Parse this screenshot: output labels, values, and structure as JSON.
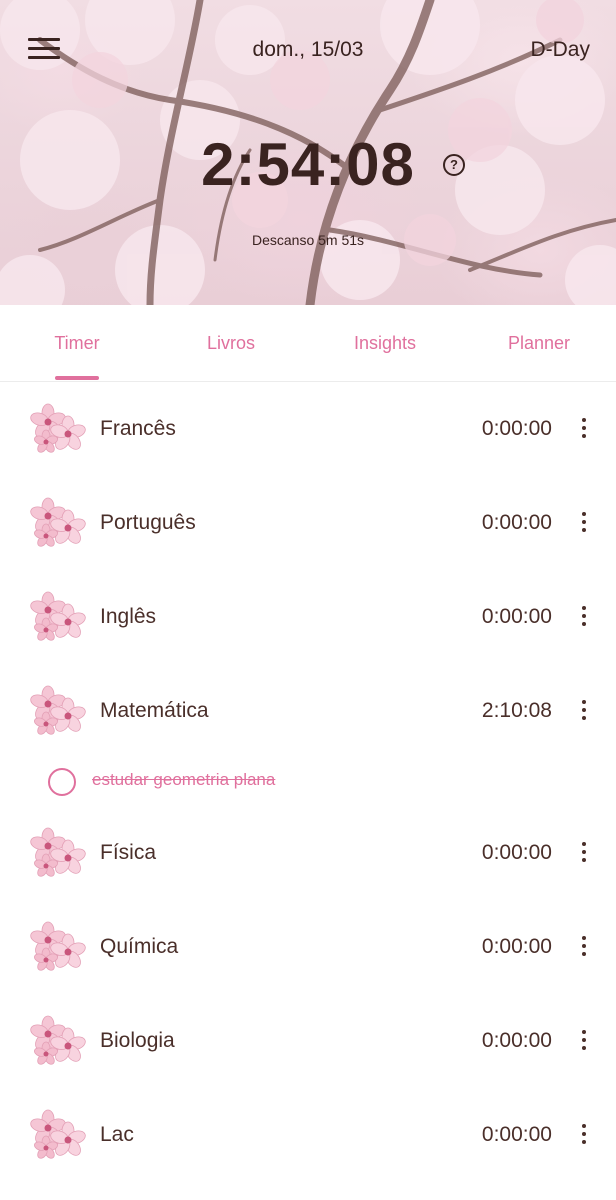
{
  "header": {
    "date": "dom., 15/03",
    "dday_label": "D-Day",
    "timer": "2:54:08",
    "help_glyph": "?",
    "rest_text": "Descanso 5m 51s"
  },
  "tabs": [
    {
      "label": "Timer",
      "active": true
    },
    {
      "label": "Livros",
      "active": false
    },
    {
      "label": "Insights",
      "active": false
    },
    {
      "label": "Planner",
      "active": false
    }
  ],
  "subjects": [
    {
      "name": "Francês",
      "time": "0:00:00",
      "icon": "cherry-blossom-icon"
    },
    {
      "name": "Português",
      "time": "0:00:00",
      "icon": "cherry-blossom-icon"
    },
    {
      "name": "Inglês",
      "time": "0:00:00",
      "icon": "cherry-blossom-icon"
    },
    {
      "name": "Matemática",
      "time": "2:10:08",
      "icon": "cherry-blossom-icon",
      "tasks": [
        {
          "text": "estudar geometria plana",
          "done": true
        }
      ]
    },
    {
      "name": "Física",
      "time": "0:00:00",
      "icon": "cherry-blossom-icon"
    },
    {
      "name": "Química",
      "time": "0:00:00",
      "icon": "cherry-blossom-icon"
    },
    {
      "name": "Biologia",
      "time": "0:00:00",
      "icon": "cherry-blossom-icon"
    },
    {
      "name": "Lac",
      "time": "0:00:00",
      "icon": "cherry-blossom-icon"
    }
  ],
  "colors": {
    "accent": "#e0709d",
    "text": "#4a2f2a",
    "header_text": "#3a2320"
  }
}
